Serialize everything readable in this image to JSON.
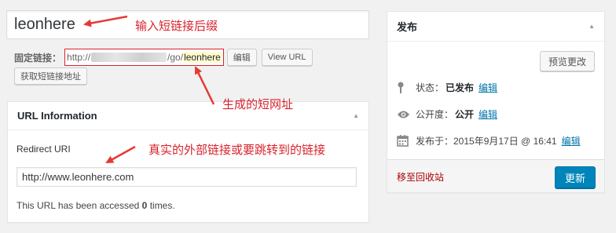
{
  "post_title": "leonhere",
  "permalink": {
    "label": "固定链接：",
    "prefix": "http://",
    "middle": "/go/",
    "slug": "leonhere",
    "edit_label": "编辑",
    "view_label": "View URL",
    "get_short_label": "获取短链接地址"
  },
  "url_box": {
    "title": "URL Information",
    "redirect_label": "Redirect URI",
    "redirect_value": "http://www.leonhere.com",
    "accessed_before": "This URL has been accessed",
    "accessed_count": "0",
    "accessed_after": "times."
  },
  "publish": {
    "title": "发布",
    "preview_label": "预览更改",
    "status_label": "状态：",
    "status_value": "已发布",
    "visibility_label": "公开度：",
    "visibility_value": "公开",
    "date_label": "发布于：2015年9月17日 @ 16:41",
    "edit_label": "编辑",
    "trash_label": "移至回收站",
    "update_label": "更新"
  },
  "annotations": {
    "title_note": "输入短链接后缀",
    "short_url_note": "生成的短网址",
    "redirect_note": "真实的外部链接或要跳转到的链接"
  },
  "icons": {
    "status": "pin-icon",
    "visibility": "eye-icon",
    "date": "calendar-icon",
    "toggle": "triangle-up-icon"
  },
  "colors": {
    "annotation": "#d9232d",
    "link": "#0073aa",
    "primary_button": "#0085ba",
    "trash": "#a00000"
  }
}
